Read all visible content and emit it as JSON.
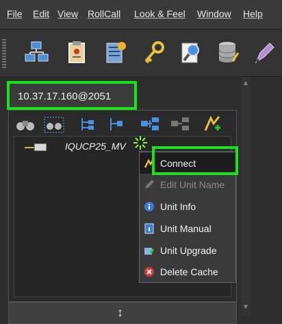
{
  "menubar": {
    "items": [
      "File",
      "Edit",
      "View",
      "RollCall",
      "Look & Feel",
      "Window",
      "Help"
    ]
  },
  "toolbar": {
    "icons": [
      "network-icon",
      "clipboard-icon",
      "server-config-icon",
      "key-icon",
      "search-doc-icon",
      "database-icon",
      "edit-icon"
    ]
  },
  "tab": {
    "label": "10.37.17.160@2051"
  },
  "panel_toolbar": {
    "icons": [
      "binoculars-icon",
      "binoculars-select-icon",
      "expand-tree-icon",
      "collapse-tree-icon",
      "connect-tree-icon",
      "disconnect-tree-icon",
      "add-unit-icon"
    ]
  },
  "tree": {
    "node_label": "IQUCP25_MV"
  },
  "context_menu": {
    "items": [
      {
        "label": "Connect",
        "icon": "connect-icon",
        "enabled": true
      },
      {
        "label": "Edit Unit Name",
        "icon": "pencil-icon",
        "enabled": false
      },
      {
        "label": "Unit Info",
        "icon": "info-icon",
        "enabled": true
      },
      {
        "label": "Unit Manual",
        "icon": "manual-icon",
        "enabled": true
      },
      {
        "label": "Unit Upgrade",
        "icon": "upgrade-icon",
        "enabled": true
      },
      {
        "label": "Delete Cache",
        "icon": "delete-icon",
        "enabled": true
      }
    ]
  },
  "bottom": {
    "resize_glyph": "↕"
  },
  "colors": {
    "highlight": "#18e418",
    "background": "#2e2e2e"
  }
}
